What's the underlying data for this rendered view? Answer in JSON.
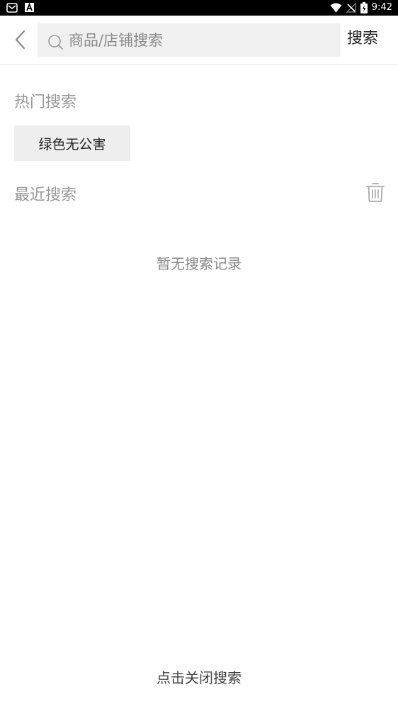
{
  "status_bar": {
    "time": "9:42",
    "left_icons": [
      "mail-icon",
      "a-icon"
    ],
    "right_icons": [
      "wifi-icon",
      "no-signal-icon",
      "battery-charging-icon"
    ]
  },
  "header": {
    "search_placeholder": "商品/店铺搜索",
    "search_value": "",
    "search_button": "搜索"
  },
  "hot_search": {
    "title": "热门搜索",
    "tags": [
      "绿色无公害"
    ]
  },
  "recent_search": {
    "title": "最近搜索",
    "empty_text": "暂无搜索记录"
  },
  "footer": {
    "close_label": "点击关闭搜索"
  },
  "colors": {
    "status_bar_bg": "#000000",
    "search_box_bg": "#f0f0f0",
    "tag_bg": "#eeeeee",
    "section_title": "#999999"
  }
}
